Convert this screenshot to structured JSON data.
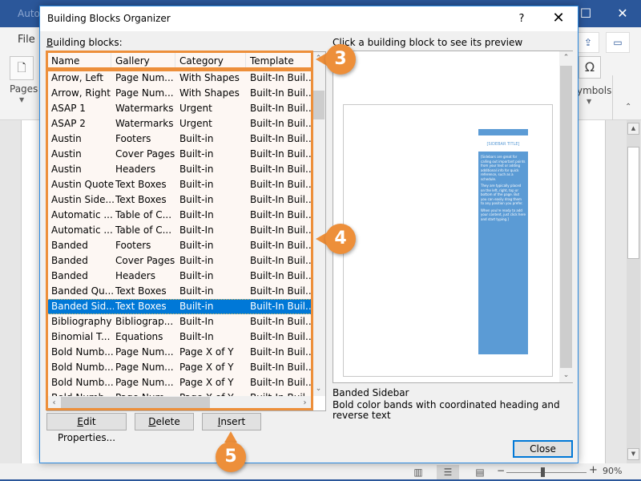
{
  "word": {
    "app_title": "AutoSave",
    "file_tab": "File",
    "pages_label": "Pages",
    "symbols_label": "ymbols",
    "zoom_level": "90%",
    "zoom_fraction": 0.45
  },
  "dialog": {
    "title": "Building Blocks Organizer",
    "help_label": "?",
    "close_glyph": "✕",
    "building_blocks_label_accel": "B",
    "building_blocks_label_rest": "uilding blocks:",
    "columns": [
      "Name",
      "Gallery",
      "Category",
      "Template"
    ],
    "rows": [
      [
        "Arrow, Left",
        "Page Num...",
        "With Shapes",
        "Built-In Buil..."
      ],
      [
        "Arrow, Right",
        "Page Num...",
        "With Shapes",
        "Built-In Buil..."
      ],
      [
        "ASAP 1",
        "Watermarks",
        "Urgent",
        "Built-In Buil..."
      ],
      [
        "ASAP 2",
        "Watermarks",
        "Urgent",
        "Built-In Buil..."
      ],
      [
        "Austin",
        "Footers",
        "Built-in",
        "Built-In Buil..."
      ],
      [
        "Austin",
        "Cover Pages",
        "Built-in",
        "Built-In Buil..."
      ],
      [
        "Austin",
        "Headers",
        "Built-in",
        "Built-In Buil..."
      ],
      [
        "Austin Quote",
        "Text Boxes",
        "Built-in",
        "Built-In Buil..."
      ],
      [
        "Austin Side...",
        "Text Boxes",
        "Built-in",
        "Built-In Buil..."
      ],
      [
        "Automatic ...",
        "Table of C...",
        "Built-In",
        "Built-In Buil..."
      ],
      [
        "Automatic ...",
        "Table of C...",
        "Built-In",
        "Built-In Buil..."
      ],
      [
        "Banded",
        "Footers",
        "Built-in",
        "Built-In Buil..."
      ],
      [
        "Banded",
        "Cover Pages",
        "Built-in",
        "Built-In Buil..."
      ],
      [
        "Banded",
        "Headers",
        "Built-in",
        "Built-In Buil..."
      ],
      [
        "Banded Qu...",
        "Text Boxes",
        "Built-in",
        "Built-In Buil..."
      ],
      [
        "Banded Sid...",
        "Text Boxes",
        "Built-in",
        "Built-In Buil..."
      ],
      [
        "Bibliography",
        "Bibliograp...",
        "Built-In",
        "Built-In Buil..."
      ],
      [
        "Binomial T...",
        "Equations",
        "Built-In",
        "Built-In Buil..."
      ],
      [
        "Bold Numb...",
        "Page Num...",
        "Page X of Y",
        "Built-In Buil..."
      ],
      [
        "Bold Numb...",
        "Page Num...",
        "Page X of Y",
        "Built-In Buil..."
      ],
      [
        "Bold Numb...",
        "Page Num...",
        "Page X of Y",
        "Built-In Buil..."
      ],
      [
        "Bold Numb...",
        "Page Num...",
        "Page X of Y",
        "Built-In Buil..."
      ]
    ],
    "selected_row_index": 15,
    "buttons": {
      "edit_accel": "E",
      "edit_rest": "dit Properties...",
      "delete_accel": "D",
      "delete_rest": "elete",
      "insert_accel": "I",
      "insert_rest": "nsert",
      "close": "Close"
    },
    "preview": {
      "label": "Click a building block to see its preview",
      "sidebar_title": "[SIDEBAR TITLE]",
      "sidebar_paragraphs": [
        "[Sidebars are great for calling out important points from your text or adding additional info for quick reference, such as a schedule.",
        "They are typically placed on the left, right, top or bottom of the page. But you can easily drag them to any position you prefer.",
        "When you're ready to add your content, just click here and start typing.]"
      ],
      "name": "Banded Sidebar",
      "description": "Bold color bands with coordinated heading and reverse text"
    }
  },
  "callouts": [
    "3",
    "4",
    "5"
  ],
  "colors": {
    "accent_orange": "#ed8f3a",
    "selection_blue": "#0078d7",
    "word_blue": "#2b579a",
    "sidebar_blue": "#5b9bd5"
  }
}
